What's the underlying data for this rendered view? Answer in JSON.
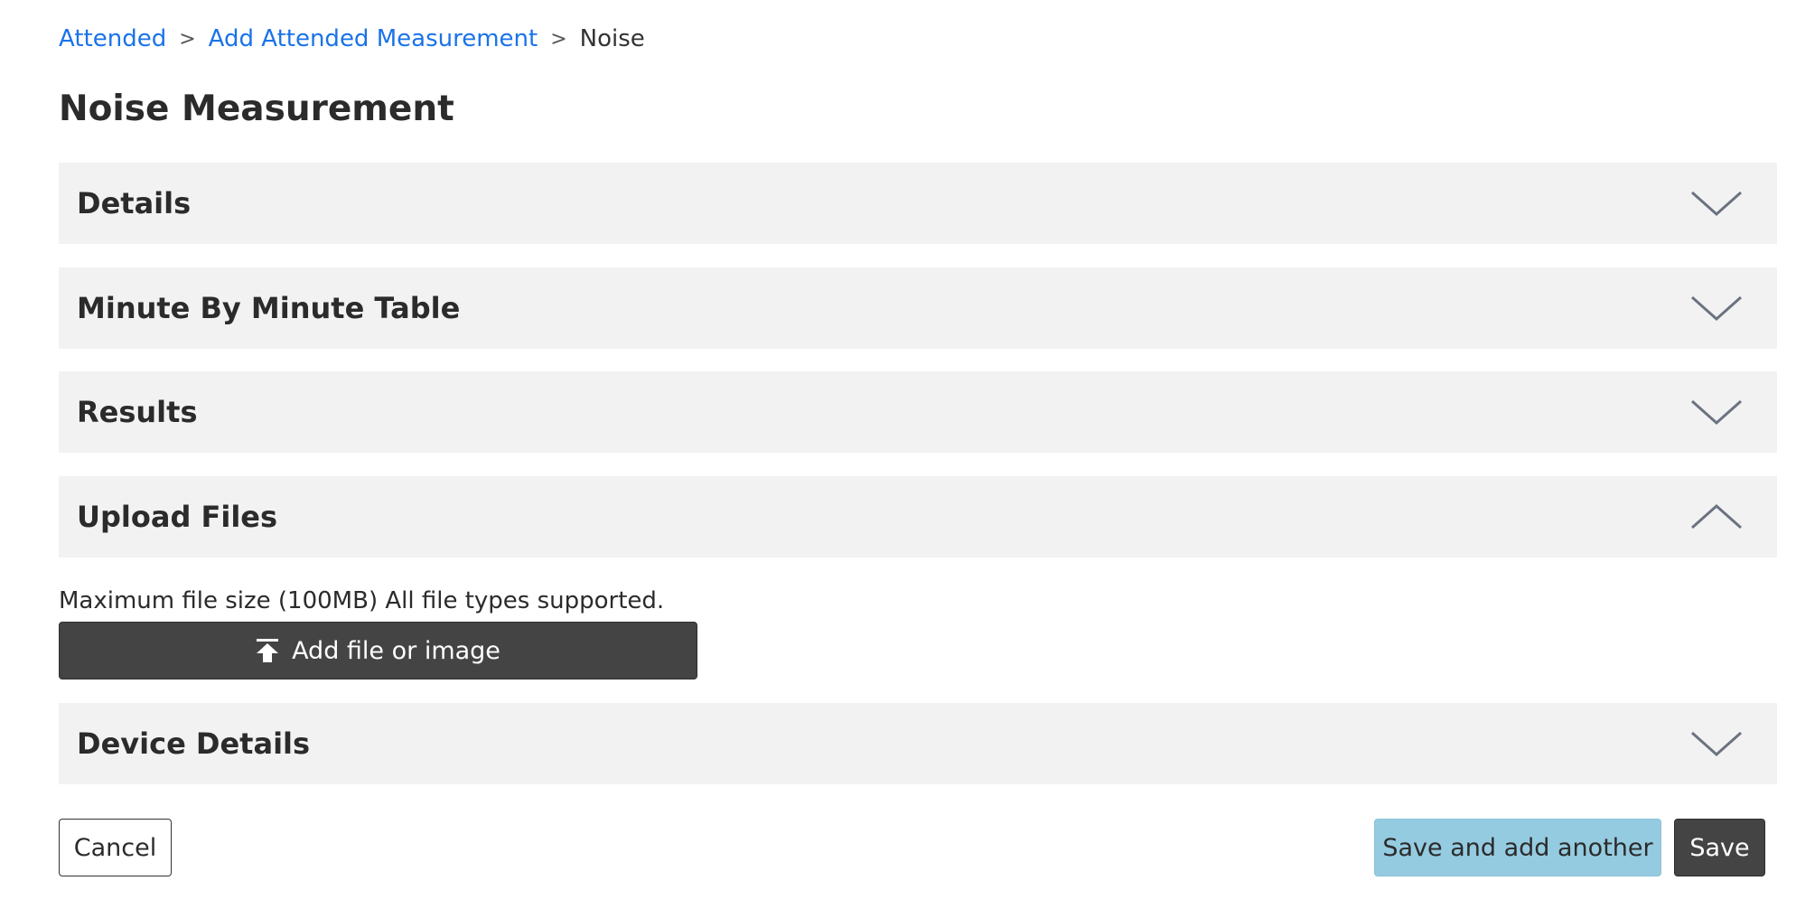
{
  "breadcrumb": {
    "items": [
      {
        "label": "Attended"
      },
      {
        "label": "Add Attended Measurement"
      }
    ],
    "separator": ">",
    "current": "Noise"
  },
  "page": {
    "title": "Noise Measurement"
  },
  "sections": {
    "details": {
      "title": "Details",
      "expanded": false,
      "icon": "chevron-down-icon"
    },
    "minute_table": {
      "title": "Minute By Minute Table",
      "expanded": false,
      "icon": "chevron-down-icon"
    },
    "results": {
      "title": "Results",
      "expanded": false,
      "icon": "chevron-down-icon"
    },
    "upload_files": {
      "title": "Upload Files",
      "expanded": true,
      "icon": "chevron-up-icon"
    },
    "device_details": {
      "title": "Device Details",
      "expanded": false,
      "icon": "chevron-down-icon"
    }
  },
  "upload": {
    "note": "Maximum file size (100MB) All file types supported.",
    "button_label": "Add file or image",
    "icon": "upload-icon"
  },
  "actions": {
    "cancel_label": "Cancel",
    "save_and_add_label": "Save and add another",
    "save_label": "Save"
  },
  "colors": {
    "link": "#1a73e8",
    "section_bg": "#f2f2f2",
    "dark_button": "#444444",
    "secondary_button": "#95cbe0",
    "chevron": "#6b7280"
  }
}
